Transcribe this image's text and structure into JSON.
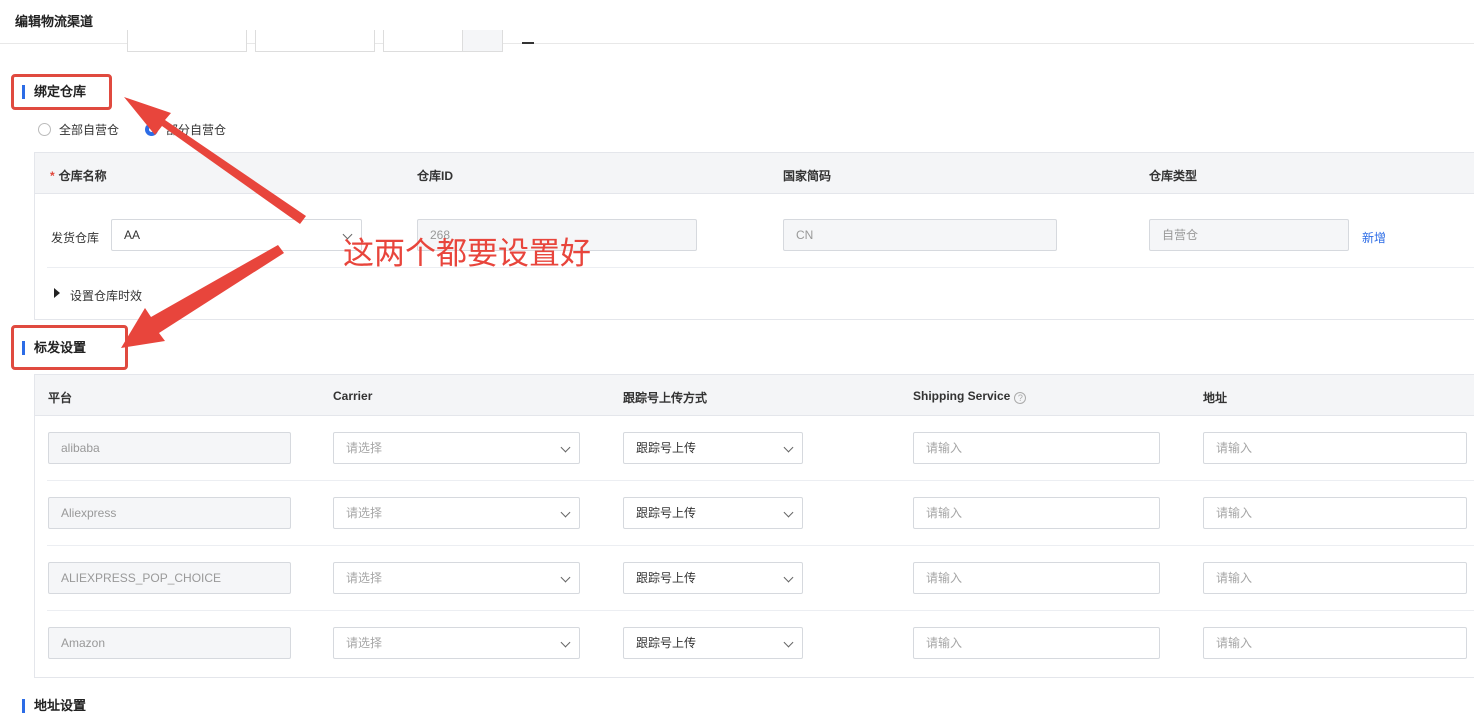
{
  "header": {
    "title": "编辑物流渠道"
  },
  "warehouse": {
    "title": "绑定仓库",
    "radio_all": "全部自营仓",
    "radio_partial": "部分自营仓",
    "columns": [
      "仓库名称",
      "仓库ID",
      "国家简码",
      "仓库类型"
    ],
    "row": {
      "label": "发货仓库",
      "name": "AA",
      "id": "268",
      "country": "CN",
      "type": "自营仓"
    },
    "add_link": "新增",
    "timing_toggle": "设置仓库时效"
  },
  "shipping": {
    "title": "标发设置",
    "columns": [
      "平台",
      "Carrier",
      "跟踪号上传方式",
      "Shipping Service",
      "地址"
    ],
    "rows": [
      {
        "platform": "alibaba",
        "carrier_placeholder": "请选择",
        "upload": "跟踪号上传",
        "service_placeholder": "请输入",
        "address_placeholder": "请输入"
      },
      {
        "platform": "Aliexpress",
        "carrier_placeholder": "请选择",
        "upload": "跟踪号上传",
        "service_placeholder": "请输入",
        "address_placeholder": "请输入"
      },
      {
        "platform": "ALIEXPRESS_POP_CHOICE",
        "carrier_placeholder": "请选择",
        "upload": "跟踪号上传",
        "service_placeholder": "请输入",
        "address_placeholder": "请输入"
      },
      {
        "platform": "Amazon",
        "carrier_placeholder": "请选择",
        "upload": "跟踪号上传",
        "service_placeholder": "请输入",
        "address_placeholder": "请输入"
      }
    ]
  },
  "address": {
    "title": "地址设置"
  },
  "annotation": {
    "text": "这两个都要设置好"
  },
  "colors": {
    "accent": "#2c6ce6",
    "annotation": "#e8453c",
    "required": "#e0463a"
  }
}
